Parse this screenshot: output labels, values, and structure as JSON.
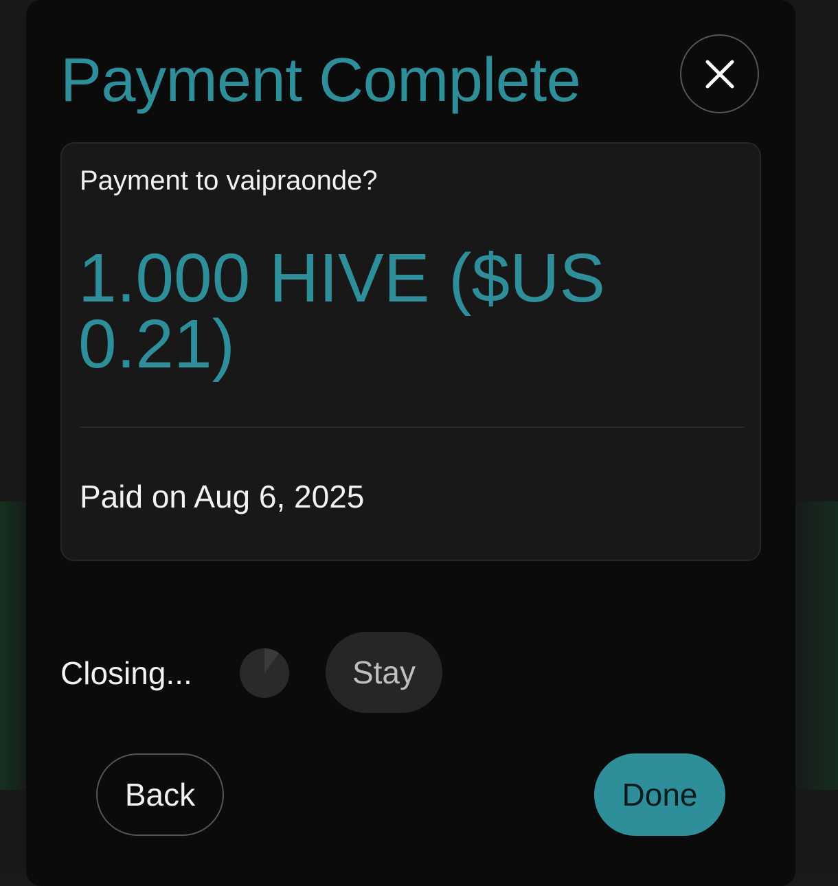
{
  "modal": {
    "title": "Payment Complete",
    "close_icon": "close-icon"
  },
  "card": {
    "label": "Payment to vaipraonde?",
    "amount": "1.000 HIVE ($US 0.21)",
    "paid_date": "Paid on Aug 6, 2025"
  },
  "auto_close": {
    "label": "Closing...",
    "timer_icon": "countdown-timer-icon",
    "progress": 0.1,
    "stay_label": "Stay"
  },
  "footer": {
    "back_label": "Back",
    "done_label": "Done"
  },
  "colors": {
    "accent": "#2e8f9b",
    "background": "#0b0b0b",
    "card": "#181818",
    "text": "#f2f2f2"
  }
}
